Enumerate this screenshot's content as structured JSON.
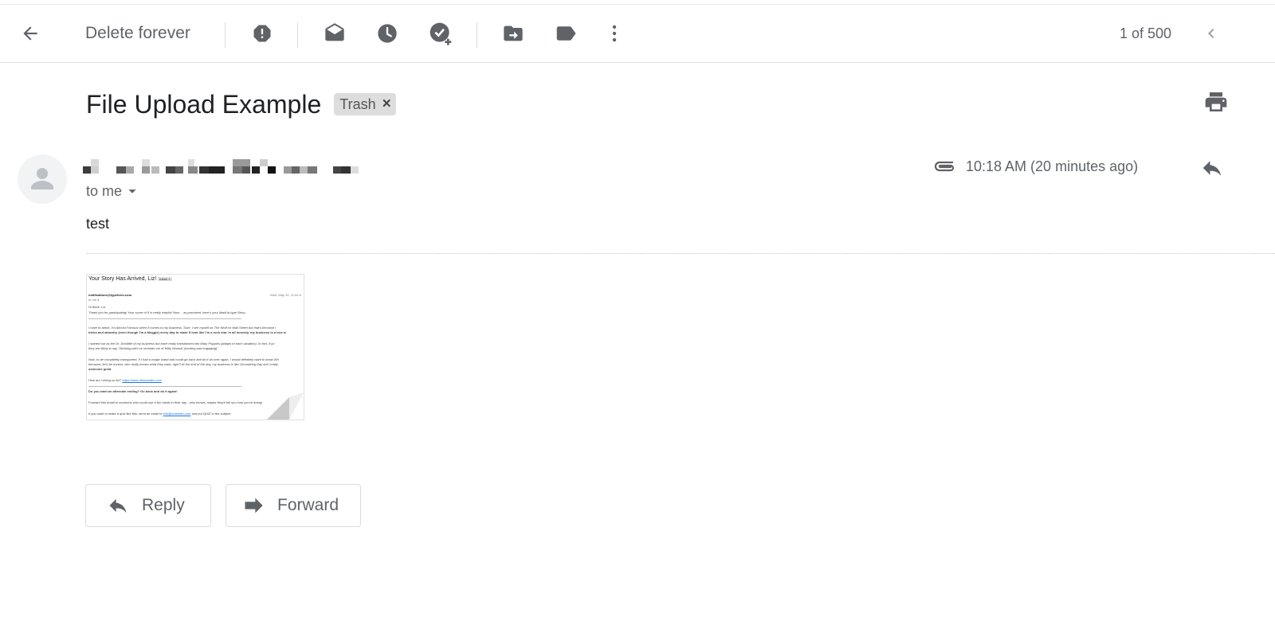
{
  "toolbar": {
    "back_icon": "arrow-left-icon",
    "delete_forever_label": "Delete forever",
    "icons": [
      "report-spam-icon",
      "mark-unread-icon",
      "snooze-icon",
      "add-to-tasks-icon",
      "move-to-icon",
      "label-icon",
      "more-vert-icon"
    ],
    "counter": "1 of 500",
    "prev_icon": "chevron-left-icon"
  },
  "message": {
    "subject": "File Upload Example",
    "label_chip": "Trash",
    "label_remove": "×",
    "print_icon": "print-icon",
    "recipient": "to me",
    "timestamp": "10:18 AM (20 minutes ago)",
    "attachment_icon": "paperclip-icon",
    "body": "test"
  },
  "attachment_preview": {
    "title": "Your Story Has Arrived, Liz!",
    "tag": "Inbox ×",
    "sender": "notifications@typeform.com",
    "date": "Wed, May 15, 11:04 A",
    "to": "to me ▾",
    "greeting": "Hi there, Liz",
    "intro": "Thank you for participating! Your score of 5 is really helpful! Now… as promised, here's your MadLib-type Story:",
    "p1a": "I have to admit, I'm Almost Famous when it comes to my business. Sure, I see myself as The Wolf on Wall Street but that's because I",
    "p1b": "tricks and wizardry (even though I'm a Muggle) every day to make it look like I'm a rock star. In all honesty, my business is a true w",
    "p2a": "I started out as the Dr. Doolittle of my business but have really transitioned into Mary Poppins (adapts to each situation). In fact, if yo",
    "p2b": "they are likely to say \"Working with Liz reminds me of Willy Wonka! (exciting and engaging)\"",
    "p3a": "Now, to be completely transparent, if I had a magic wand and could go back and do it all over again, I would definitely want to know Wh",
    "p3b": "because, let's be honest, who really knows what they want, right? At the end of the day, my business is like Groundhog Day but I really",
    "p3c": "someone great",
    "how": "How am I doing so far?",
    "link": "https://www.libreamatic.com",
    "alt_q": "Do you want an alternate ending? Go back and do it again!",
    "forward": "Forward this email to someone who could use a fun break in their day - who knows, maybe they'll tell you how you're doing!",
    "quiz_a": "If you want to make a quiz like this, send an email to",
    "quiz_link": "info@outsmart.com",
    "quiz_b": "and put QUIZ in the subject."
  },
  "actions": {
    "reply_label": "Reply",
    "forward_label": "Forward"
  }
}
